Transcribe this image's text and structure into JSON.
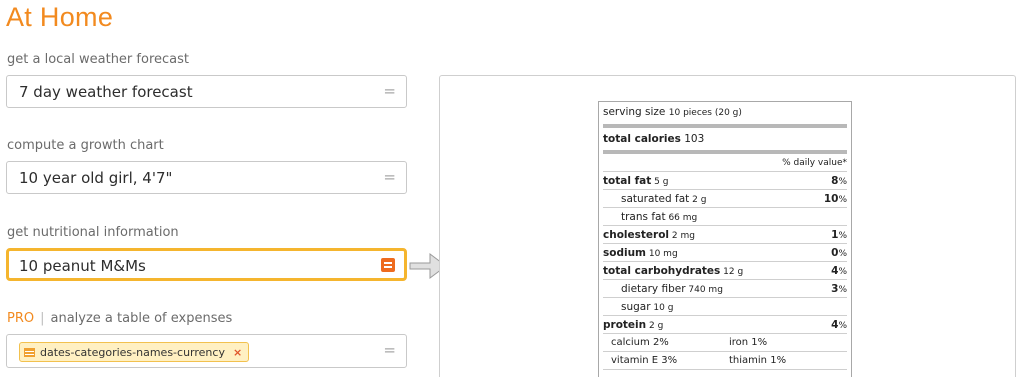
{
  "page_title": "At Home",
  "sections": [
    {
      "label": "get a local weather forecast",
      "value": "7 day weather forecast"
    },
    {
      "label": "compute a growth chart",
      "value": "10 year old girl, 4'7\""
    },
    {
      "label": "get nutritional information",
      "value": "10 peanut M&Ms"
    }
  ],
  "pro_section": {
    "badge": "PRO",
    "separator": "|",
    "label": "analyze a table of expenses",
    "chip": "dates-categories-names-currency",
    "chip_remove": "×"
  },
  "equals_glyph": "=",
  "nutrition": {
    "serving_label": "serving size",
    "serving_value": "10 pieces (20 g)",
    "calories_label": "total calories",
    "calories_value": "103",
    "dv_header": "% daily value*",
    "rows": [
      {
        "name": "total fat",
        "amount": "5 g",
        "dv": "8",
        "bold": true
      },
      {
        "name": "saturated fat",
        "amount": "2 g",
        "dv": "10",
        "sub": true
      },
      {
        "name": "trans fat",
        "amount": "66 mg",
        "dv": "",
        "sub": true
      },
      {
        "name": "cholesterol",
        "amount": "2 mg",
        "dv": "1",
        "bold": true
      },
      {
        "name": "sodium",
        "amount": "10 mg",
        "dv": "0",
        "bold": true
      },
      {
        "name": "total carbohydrates",
        "amount": "12 g",
        "dv": "4",
        "bold": true
      },
      {
        "name": "dietary fiber",
        "amount": "740 mg",
        "dv": "3",
        "sub": true
      },
      {
        "name": "sugar",
        "amount": "10 g",
        "dv": "",
        "sub": true
      },
      {
        "name": "protein",
        "amount": "2 g",
        "dv": "4",
        "bold": true
      }
    ],
    "minerals": [
      {
        "left": "calcium 2%",
        "right": "iron 1%"
      },
      {
        "left": "vitamin E 3%",
        "right": "thiamin 1%"
      }
    ]
  },
  "colors": {
    "accent": "#f28a1f",
    "focus": "#f5b52e",
    "button": "#ee6b1f"
  }
}
